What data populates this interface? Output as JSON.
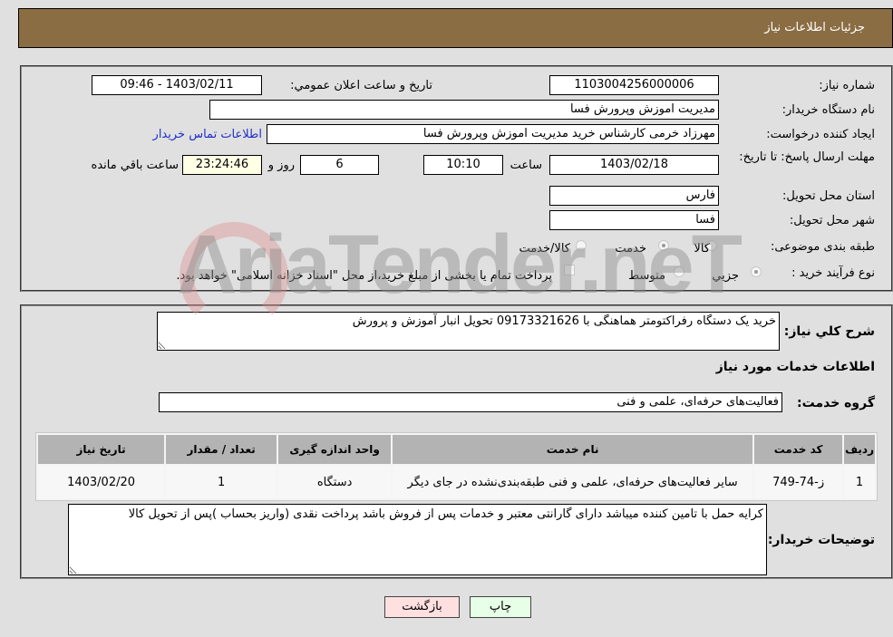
{
  "header": {
    "title": "جزئیات اطلاعات نیاز"
  },
  "fields": {
    "need_number_label": "شماره نیاز:",
    "need_number": "1103004256000006",
    "announce_label": "تاریخ و ساعت اعلان عمومي:",
    "announce_value": "1403/02/11 - 09:46",
    "buyer_org_label": "نام دستگاه خریدار:",
    "buyer_org": "مدیریت اموزش وپرورش فسا",
    "creator_label": "ایجاد کننده درخواست:",
    "creator": "مهرزاد خرمی کارشناس خرید مدیریت اموزش وپرورش فسا",
    "contact_link": "اطلاعات تماس خریدار",
    "deadline_label": "مهلت ارسال پاسخ: تا تاریخ:",
    "deadline_date": "1403/02/18",
    "time_label": "ساعت",
    "deadline_time": "10:10",
    "days_value": "6",
    "days_label": "روز و",
    "remaining_time": "23:24:46",
    "remaining_label": "ساعت باقي مانده",
    "province_label": "استان محل تحویل:",
    "province": "فارس",
    "city_label": "شهر محل تحویل:",
    "city": "فسا",
    "category_label": "طبقه بندی موضوعی:",
    "category_options": [
      {
        "label": "کالا",
        "selected": false
      },
      {
        "label": "خدمت",
        "selected": true
      },
      {
        "label": "کالا/خدمت",
        "selected": false
      }
    ],
    "process_label": "نوع فرآیند خرید :",
    "process_options": [
      {
        "label": "جزیي",
        "selected": true
      },
      {
        "label": "متوسط",
        "selected": false
      }
    ],
    "treasury_checkbox_label": "پرداخت تمام یا بخشی از مبلغ خرید،از محل \"اسناد خزانه اسلامی\" خواهد بود.",
    "treasury_checked": false
  },
  "description": {
    "label": "شرح کلي نیاز:",
    "value": "خرید یک دستگاه رفراکتومتر هماهنگی با 09173321626 تحویل انبار آموزش و پرورش"
  },
  "services": {
    "section_title": "اطلاعات خدمات مورد نیاز",
    "group_label": "گروه خدمت:",
    "group_value": "فعالیت‌های حرفه‌ای، علمی و فنی",
    "table": {
      "headers": [
        "ردیف",
        "کد خدمت",
        "نام خدمت",
        "واحد اندازه گیری",
        "تعداد / مقدار",
        "تاریخ نیاز"
      ],
      "rows": [
        [
          "1",
          "ز-74-749",
          "سایر فعالیت‌های حرفه‌ای، علمی و فنی طبقه‌بندی‌نشده در جای دیگر",
          "دستگاه",
          "1",
          "1403/02/20"
        ]
      ]
    }
  },
  "buyer_notes": {
    "label": "توضیحات خریدار:",
    "value": "کرایه حمل با تامین کننده میباشد دارای گارانتی معتبر و خدمات پس از فروش باشد پرداخت نقدی (واریز بحساب )پس از تحویل کالا"
  },
  "buttons": {
    "print": "چاپ",
    "back": "بازگشت"
  },
  "watermark": {
    "text": "AriaTender.neT"
  },
  "colors": {
    "header_bg": "#8b6d43",
    "print_bg": "#e6ffe6",
    "back_bg": "#ffe0e0",
    "link": "#1f2ec9"
  }
}
